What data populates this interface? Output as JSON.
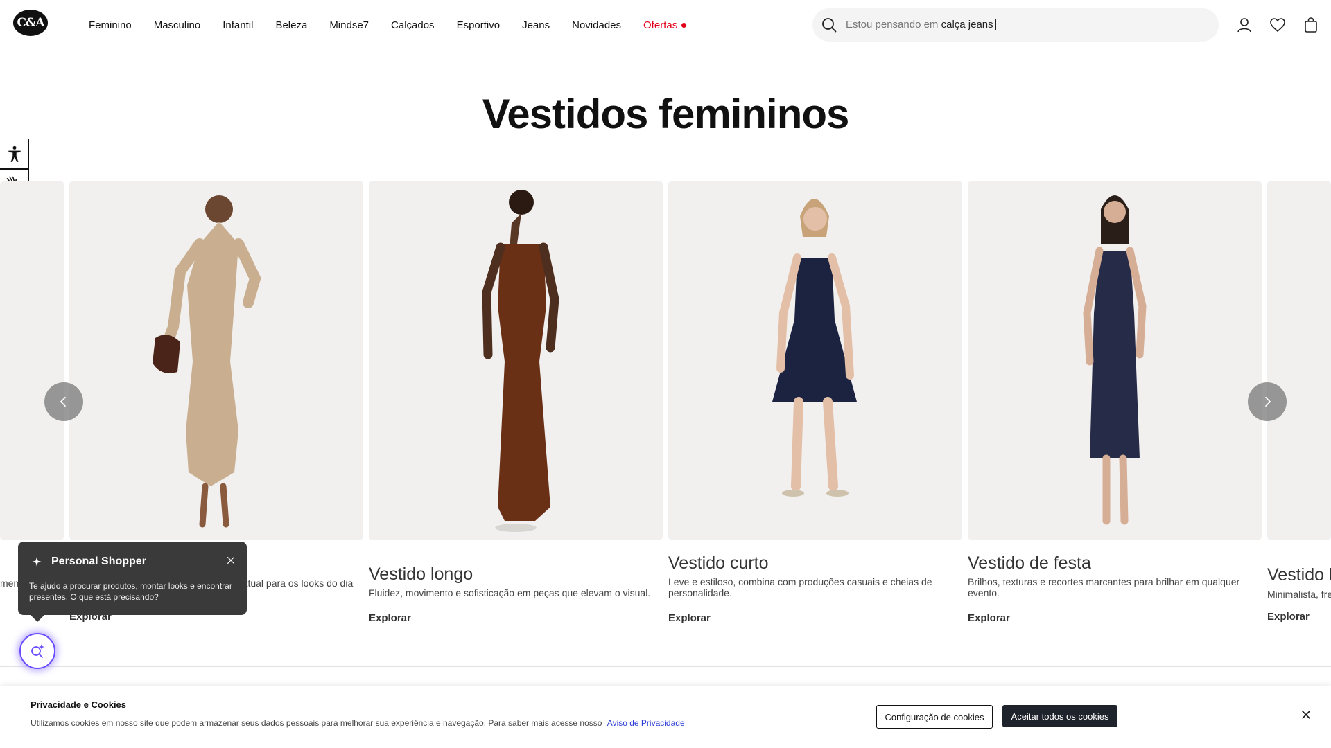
{
  "header": {
    "logo": "C&A",
    "nav": [
      "Feminino",
      "Masculino",
      "Infantil",
      "Beleza",
      "Mindse7",
      "Calçados",
      "Esportivo",
      "Jeans",
      "Novidades"
    ],
    "offers_label": "Ofertas",
    "search_placeholder": "Estou pensando em",
    "search_suggestion": "calça jeans"
  },
  "page_title": "Vestidos femininos",
  "carousel": {
    "peek_left_text": "men",
    "partial_desc": "e atual para os looks do dia",
    "partial_cta": "Explorar",
    "cards": [
      {
        "name": "Vestido longo",
        "desc": "Fluidez, movimento e sofisticação em peças que elevam o visual.",
        "cta": "Explorar"
      },
      {
        "name": "Vestido curto",
        "desc": "Leve e estiloso, combina com produções casuais e cheias de personalidade.",
        "cta": "Explorar"
      },
      {
        "name": "Vestido de festa",
        "desc": "Brilhos, texturas e recortes marcantes para brilhar em qualquer evento.",
        "cta": "Explorar"
      }
    ],
    "peek_right": {
      "name": "Vestido b",
      "desc": "Minimalista, fre",
      "cta": "Explorar"
    }
  },
  "personal_shopper": {
    "title": "Personal Shopper",
    "text": "Te ajudo a procurar produtos, montar looks e encontrar presentes. O que está precisando?"
  },
  "cookies": {
    "title": "Privacidade e Cookies",
    "text": "Utilizamos cookies em nosso site que podem armazenar seus dados pessoais para melhorar sua experiência e navegação. Para saber mais acesse nosso",
    "link": "Aviso de Privacidade",
    "settings_button": "Configuração de cookies",
    "accept_button": "Aceitar todos os cookies"
  },
  "colors": {
    "offer": "#e3001b",
    "accept_bg": "#1f232b",
    "shopper_ring": "#6a4bff"
  }
}
